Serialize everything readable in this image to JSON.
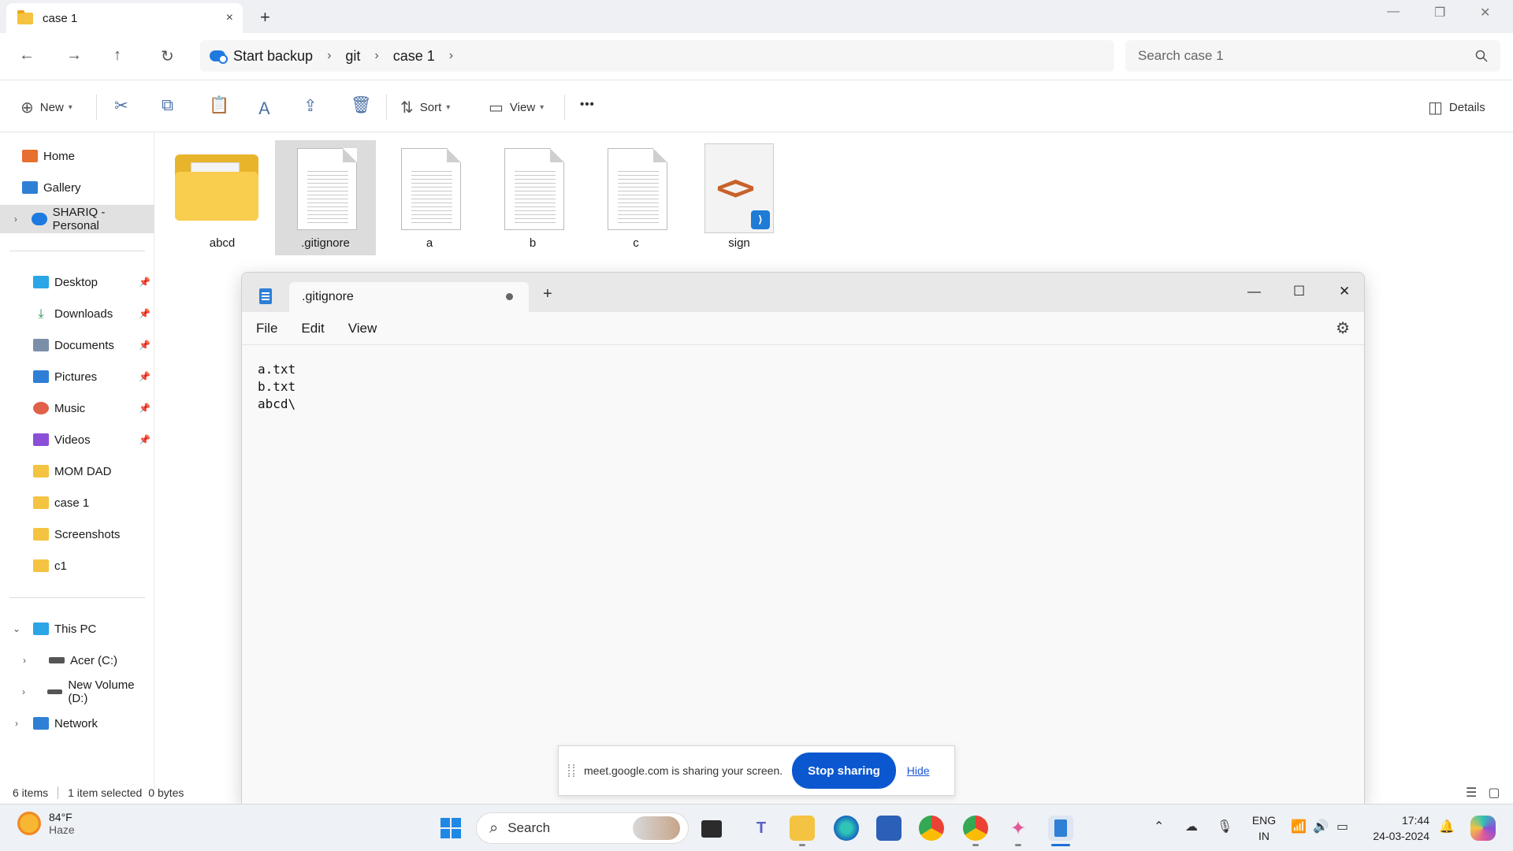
{
  "explorer": {
    "tab_title": "case 1",
    "tab_close": "×",
    "tab_new": "+",
    "window_controls": {
      "minimize": "—",
      "restore": "❐",
      "close": "✕"
    },
    "nav": {
      "back": "←",
      "forward": "→",
      "up": "↑",
      "refresh": "↻"
    },
    "breadcrumb": [
      "Start backup",
      "git",
      "case 1"
    ],
    "breadcrumb_sep": "›",
    "search_placeholder": "Search case 1",
    "commands": {
      "new": "New",
      "sort": "Sort",
      "view": "View",
      "more": "•••",
      "details": "Details"
    },
    "sidebar": {
      "top": [
        {
          "label": "Home",
          "icon": "home-icon"
        },
        {
          "label": "Gallery",
          "icon": "gallery-icon"
        },
        {
          "label": "SHARIQ - Personal",
          "icon": "onedrive-icon",
          "selected": true
        }
      ],
      "quick": [
        {
          "label": "Desktop",
          "icon": "desktop-icon",
          "pinned": true
        },
        {
          "label": "Downloads",
          "icon": "downloads-icon",
          "pinned": true
        },
        {
          "label": "Documents",
          "icon": "documents-icon",
          "pinned": true
        },
        {
          "label": "Pictures",
          "icon": "pictures-icon",
          "pinned": true
        },
        {
          "label": "Music",
          "icon": "music-icon",
          "pinned": true
        },
        {
          "label": "Videos",
          "icon": "videos-icon",
          "pinned": true
        },
        {
          "label": "MOM DAD",
          "icon": "folder-icon"
        },
        {
          "label": "case 1",
          "icon": "folder-icon"
        },
        {
          "label": "Screenshots",
          "icon": "folder-icon"
        },
        {
          "label": "c1",
          "icon": "folder-icon"
        }
      ],
      "this_pc": "This PC",
      "drives": [
        "Acer (C:)",
        "New Volume (D:)"
      ],
      "network": "Network"
    },
    "files": [
      {
        "name": "abcd",
        "kind": "folder"
      },
      {
        "name": ".gitignore",
        "kind": "text",
        "selected": true
      },
      {
        "name": "a",
        "kind": "text"
      },
      {
        "name": "b",
        "kind": "text"
      },
      {
        "name": "c",
        "kind": "text"
      },
      {
        "name": "sign",
        "kind": "vscode"
      }
    ],
    "status": {
      "count": "6 items",
      "selection": "1 item selected",
      "size": "0 bytes"
    }
  },
  "notepad": {
    "tab_title": ".gitignore",
    "tab_new": "+",
    "menu": [
      "File",
      "Edit",
      "View"
    ],
    "content_lines": [
      "a.txt",
      "b.txt",
      "abcd\\"
    ],
    "controls": {
      "minimize": "—",
      "maximize": "☐",
      "close": "✕"
    }
  },
  "share_banner": {
    "message": "meet.google.com is sharing your screen.",
    "stop": "Stop sharing",
    "hide": "Hide"
  },
  "taskbar": {
    "weather_temp": "84°F",
    "weather_desc": "Haze",
    "search": "Search",
    "lang_top": "ENG",
    "lang_bottom": "IN",
    "time": "17:44",
    "date": "24-03-2024"
  },
  "colors": {
    "accent": "#0b57d0",
    "folder": "#f9cd4e",
    "selection": "#dcdcdc"
  }
}
